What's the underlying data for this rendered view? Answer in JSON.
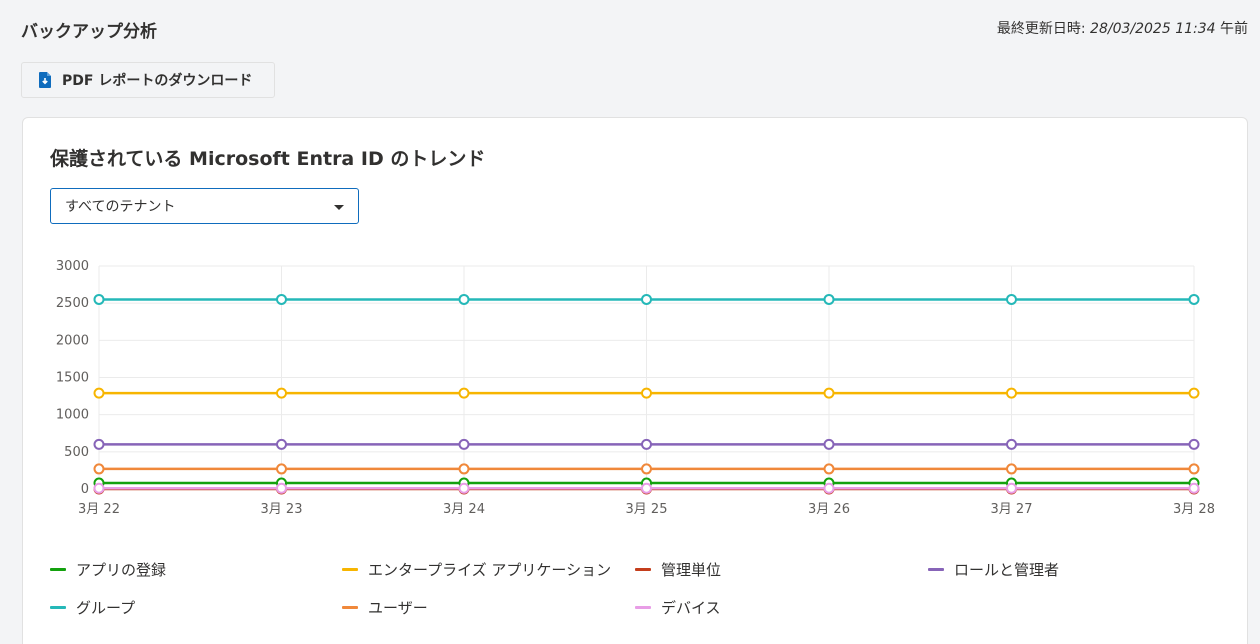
{
  "header": {
    "title": "バックアップ分析",
    "last_updated_label": "最終更新日時: ",
    "last_updated_value": "28/03/2025 11:34",
    "last_updated_suffix": " 午前"
  },
  "toolbar": {
    "pdf_icon": "file-download-icon",
    "pdf_label": "PDF レポートのダウンロード"
  },
  "card": {
    "title": "保護されている Microsoft Entra ID のトレンド",
    "tenant_select": {
      "selected": "すべてのテナント"
    }
  },
  "colors": {
    "accent": "#0f6cbd"
  },
  "chart_data": {
    "type": "line",
    "title": "",
    "xlabel": "",
    "ylabel": "",
    "ylim": [
      0,
      3000
    ],
    "y_ticks": [
      0,
      500,
      1000,
      1500,
      2000,
      2500,
      3000
    ],
    "x": [
      "3月 22",
      "3月 23",
      "3月 24",
      "3月 25",
      "3月 26",
      "3月 27",
      "3月 28"
    ],
    "grid": true,
    "legend_position": "bottom",
    "series": [
      {
        "name": "アプリの登録",
        "color": "#13a10e",
        "values": [
          80,
          80,
          80,
          80,
          80,
          80,
          80
        ]
      },
      {
        "name": "エンタープライズ アプリケーション",
        "color": "#f7b500",
        "values": [
          1290,
          1290,
          1290,
          1290,
          1290,
          1290,
          1290
        ]
      },
      {
        "name": "管理単位",
        "color": "#c43e1c",
        "values": [
          0,
          0,
          0,
          0,
          0,
          0,
          0
        ]
      },
      {
        "name": "ロールと管理者",
        "color": "#8764b8",
        "values": [
          600,
          600,
          600,
          600,
          600,
          600,
          600
        ]
      },
      {
        "name": "グループ",
        "color": "#25b8b8",
        "values": [
          2550,
          2550,
          2550,
          2550,
          2550,
          2550,
          2550
        ]
      },
      {
        "name": "ユーザー",
        "color": "#f0883a",
        "values": [
          270,
          270,
          270,
          270,
          270,
          270,
          270
        ]
      },
      {
        "name": "デバイス",
        "color": "#e89de6",
        "values": [
          10,
          10,
          10,
          10,
          10,
          10,
          10
        ]
      }
    ]
  }
}
